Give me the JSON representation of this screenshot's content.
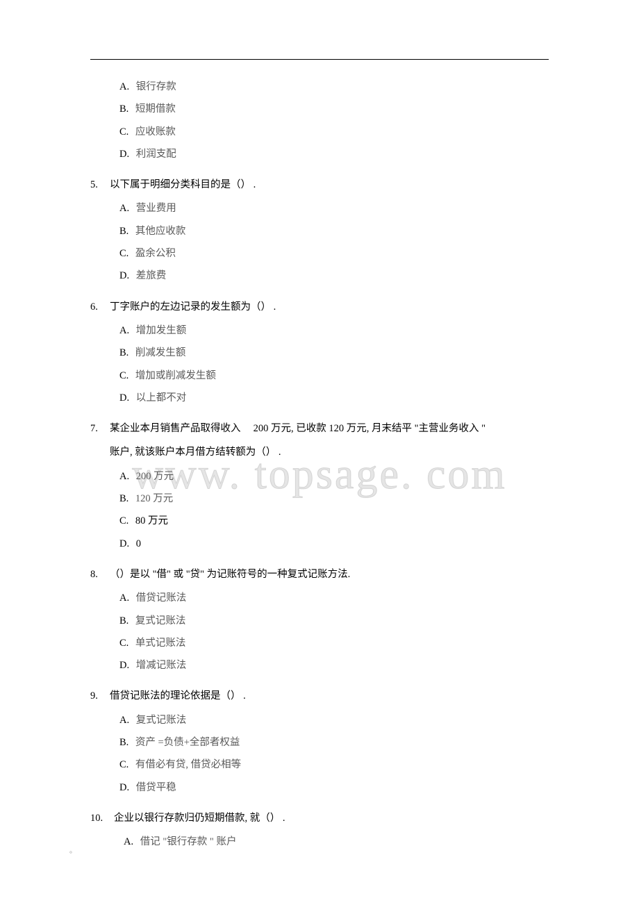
{
  "watermark": "www. topsage. com",
  "q4_options": {
    "a_letter": "A.",
    "a_text": "银行存款",
    "b_letter": "B.",
    "b_text": "短期借款",
    "c_letter": "C.",
    "c_text": "应收账款",
    "d_letter": "D.",
    "d_text": "利润支配"
  },
  "q5": {
    "num": "5.",
    "text": "以下属于明细分类科目的是（）   .",
    "a_letter": "A.",
    "a_text": "营业费用",
    "b_letter": "B.",
    "b_text": "其他应收款",
    "c_letter": "C.",
    "c_text": "盈余公积",
    "d_letter": "D.",
    "d_text": "差旅费"
  },
  "q6": {
    "num": "6.",
    "text": "丁字账户的左边记录的发生额为（）    .",
    "a_letter": "A.",
    "a_text": "增加发生额",
    "b_letter": "B.",
    "b_text": "削减发生额",
    "c_letter": "C.",
    "c_text": "增加或削减发生额",
    "d_letter": "D.",
    "d_text": "以上都不对"
  },
  "q7": {
    "num": "7.",
    "text_part1": "某企业本月销售产品取得收入",
    "text_part2": "200 万元, 已收款  120 万元, 月末结平  \"主营业务收入 \"",
    "text_line2": "账户, 就该账户本月借方结转额为（）     .",
    "a_letter": "A.",
    "a_text": "200 万元",
    "b_letter": "B.",
    "b_text": "120 万元",
    "c_letter": "C.",
    "c_text": "80 万元",
    "d_letter": "D.",
    "d_text": "0"
  },
  "q8": {
    "num": "8.",
    "text": "（）是以 \"借\" 或 \"贷\" 为记账符号的一种复式记账方法.",
    "a_letter": "A.",
    "a_text": "借贷记账法",
    "b_letter": "B.",
    "b_text": "复式记账法",
    "c_letter": "C.",
    "c_text": "单式记账法",
    "d_letter": "D.",
    "d_text": "增减记账法"
  },
  "q9": {
    "num": "9.",
    "text": "借贷记账法的理论依据是（）   .",
    "a_letter": "A.",
    "a_text": "复式记账法",
    "b_letter": "B.",
    "b_text": "资产  =负债+全部者权益",
    "c_letter": "C.",
    "c_text": "有借必有贷, 借贷必相等",
    "d_letter": "D.",
    "d_text": "借贷平稳"
  },
  "q10": {
    "num": "10.",
    "text": "企业以银行存款归仍短期借款, 就（）     .",
    "a_letter": "A.",
    "a_text": "借记 \"银行存款 \" 账户"
  },
  "bottom": "。"
}
